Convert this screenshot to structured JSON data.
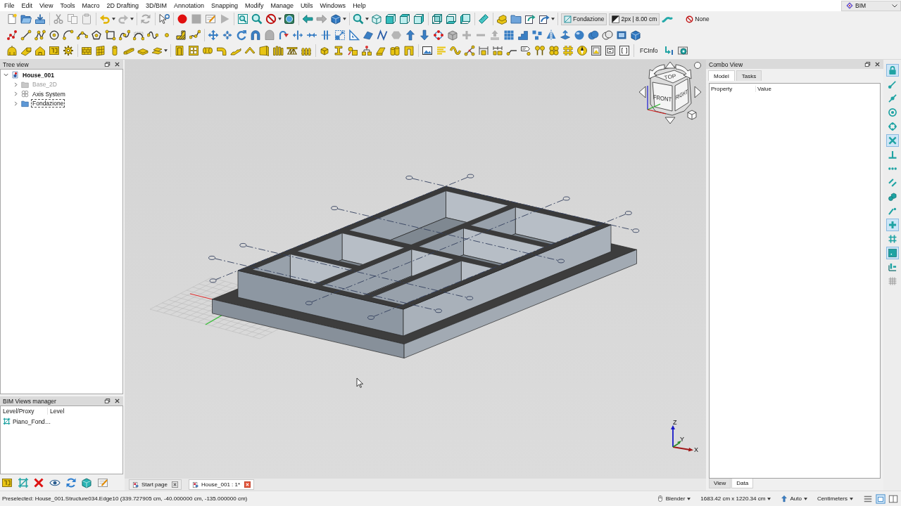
{
  "menu_bar": {
    "items": [
      "File",
      "Edit",
      "View",
      "Tools",
      "Macro",
      "2D Drafting",
      "3D/BIM",
      "Annotation",
      "Snapping",
      "Modify",
      "Manage",
      "Utils",
      "Windows",
      "Help"
    ]
  },
  "workbench_selector": {
    "value": "BIM"
  },
  "toolbar": {
    "working_plane_button": "Fondazione",
    "style_button": "2px | 8.00 cm",
    "layer_button": "None",
    "fcinfo_label": "FCInfo"
  },
  "snap_toolbar": [
    {
      "on": true
    },
    {
      "on": false
    },
    {
      "on": false
    },
    {
      "on": false
    },
    {
      "on": false
    },
    {
      "on": true
    },
    {
      "on": false
    },
    {
      "on": false
    },
    {
      "on": false
    },
    {
      "on": false
    },
    {
      "on": false
    },
    {
      "on": true
    },
    {
      "on": false
    },
    {
      "on": true
    },
    {
      "on": false
    },
    {
      "on": false
    }
  ],
  "tree_view": {
    "title": "Tree view",
    "items": [
      {
        "label": "House_001",
        "kind": "document",
        "expanded": true,
        "visible": true,
        "focused": false,
        "children": [
          {
            "label": "Base_2D",
            "kind": "folder",
            "expanded": false,
            "visible": false,
            "focused": false
          },
          {
            "label": "Axis System",
            "kind": "axis_system",
            "expanded": false,
            "visible": true,
            "focused": false
          },
          {
            "label": "Fondazione",
            "kind": "folder",
            "expanded": false,
            "visible": true,
            "focused": true
          }
        ]
      }
    ]
  },
  "bim_views_manager": {
    "title": "BIM Views manager",
    "columns": [
      "Level/Proxy",
      "Level"
    ],
    "rows": [
      {
        "label": "Piano_Fond…"
      }
    ]
  },
  "viewport": {
    "navigation_cube": {
      "faces": [
        "FRONT",
        "RIGHT",
        "TOP"
      ]
    },
    "axis_labels": [
      "Z",
      "Y",
      "X"
    ]
  },
  "document_tabs": [
    {
      "label": "Start page",
      "selected": false
    },
    {
      "label": "House_001 : 1*",
      "selected": true
    }
  ],
  "combo_view": {
    "title": "Combo View",
    "tabs": [
      {
        "label": "Model",
        "selected": true
      },
      {
        "label": "Tasks",
        "selected": false
      }
    ],
    "property_columns": [
      "Property",
      "Value"
    ],
    "bottom_tabs": [
      {
        "label": "View",
        "selected": false
      },
      {
        "label": "Data",
        "selected": true
      }
    ]
  },
  "status_bar": {
    "message": "Preselected: House_001.Structure034.Edge10 (339.727905 cm, -40.000000 cm, -135.000000 cm)",
    "navigation_style": "Blender",
    "view_size": "1683.42 cm x 1220.34 cm",
    "unit_mode": "Auto",
    "unit_system": "Centimeters"
  }
}
